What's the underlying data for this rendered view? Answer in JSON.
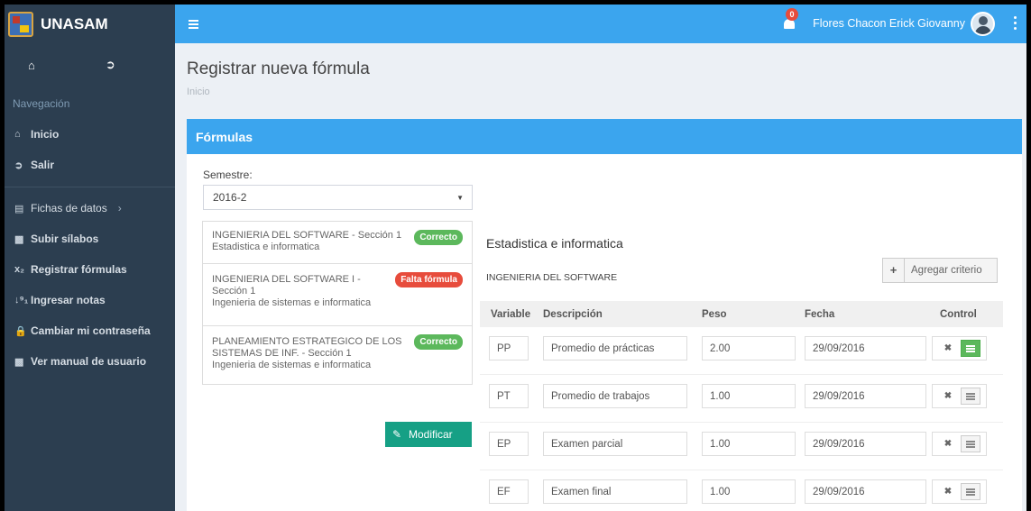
{
  "brand": {
    "name": "UNASAM"
  },
  "topbar": {
    "notification_count": "0",
    "user_name": "Flores Chacon Erick Giovanny"
  },
  "sidebar": {
    "header": "Navegación",
    "items": [
      {
        "label": "Inicio",
        "icon": "home-icon"
      },
      {
        "label": "Salir",
        "icon": "sign-out-icon"
      },
      {
        "label": "Fichas de datos",
        "icon": "bar-chart-icon",
        "chevron": "›"
      },
      {
        "label": "Subir sílabos",
        "icon": "book-icon"
      },
      {
        "label": "Registrar fórmulas",
        "icon": "subscript-icon",
        "icon_text": "x₂"
      },
      {
        "label": "Ingresar notas",
        "icon": "sort-numeric-icon",
        "icon_text": "↓⁹₁"
      },
      {
        "label": "Cambiar mi contraseña",
        "icon": "lock-icon"
      },
      {
        "label": "Ver manual de usuario",
        "icon": "book-icon"
      }
    ]
  },
  "page": {
    "title": "Registrar nueva fórmula",
    "breadcrumb": "Inicio"
  },
  "panel": {
    "title": "Fórmulas",
    "semester_label": "Semestre:",
    "semester_value": "2016-2",
    "modify_button": "Modificar"
  },
  "courses": [
    {
      "name": "INGENIERIA DEL SOFTWARE - Sección 1",
      "school": "Estadistica e informatica",
      "status": "Correcto"
    },
    {
      "name_line1": "INGENIERIA DEL SOFTWARE I -",
      "name_line2": "Sección 1",
      "school": "Ingenieria de sistemas e informatica",
      "status": "Falta fórmula"
    },
    {
      "name_line1": "PLANEAMIENTO ESTRATEGICO DE LOS",
      "name_line2": "SISTEMAS DE INF. - Sección 1",
      "school": "Ingenieria de sistemas e informatica",
      "status": "Correcto"
    }
  ],
  "detail": {
    "title": "Estadistica e informatica",
    "subtitle": "INGENIERIA DEL SOFTWARE",
    "add_button": "Agregar criterio",
    "columns": [
      "Variable",
      "Descripción",
      "Peso",
      "Fecha",
      "Control"
    ],
    "rows": [
      {
        "variable": "PP",
        "description": "Promedio de prácticas",
        "weight": "2.00",
        "date": "29/09/2016",
        "active": true
      },
      {
        "variable": "PT",
        "description": "Promedio de trabajos",
        "weight": "1.00",
        "date": "29/09/2016",
        "active": false
      },
      {
        "variable": "EP",
        "description": "Examen parcial",
        "weight": "1.00",
        "date": "29/09/2016",
        "active": false
      },
      {
        "variable": "EF",
        "description": "Examen final",
        "weight": "1.00",
        "date": "29/09/2016",
        "active": false
      }
    ]
  },
  "colors": {
    "topbar": "#3ba5ee",
    "sidebar": "#2c3e50",
    "success": "#5cb85c",
    "danger": "#e74c3c",
    "modify": "#16a085"
  }
}
